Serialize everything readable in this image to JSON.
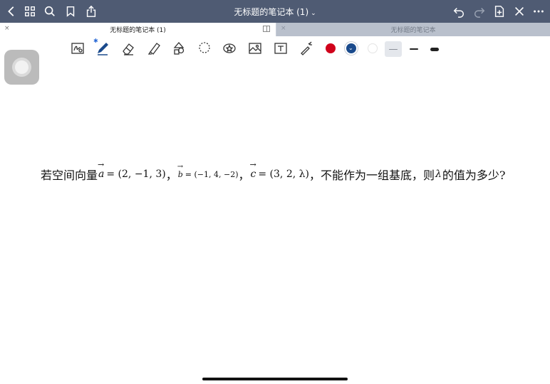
{
  "window": {
    "title": "无标题的笔记本 (1)",
    "title_caret": "⌄"
  },
  "tabs": [
    {
      "label": "无标题的笔记本 (1)",
      "close": "×",
      "active": true
    },
    {
      "label": "无标题的笔记本",
      "close": "×",
      "active": false
    }
  ],
  "toolbar": {
    "bluetooth_mark": "✱",
    "colors": {
      "red": "#d0021b",
      "navy": "#1a4a8c",
      "white": "#ffffff"
    },
    "selected_color": "navy"
  },
  "content": {
    "prefix": "若空间向量",
    "a_symbol": "a",
    "a_value": "= (2, −1, 3)",
    "sep": "，",
    "b_symbol": "b",
    "b_value": "= (−1, 4, −2)",
    "c_symbol": "c",
    "c_value": "= (3, 2, λ)",
    "middle": "，不能作为一组基底，则",
    "lambda": "λ",
    "suffix": "的值为多少?"
  },
  "vector_arrow": "→"
}
